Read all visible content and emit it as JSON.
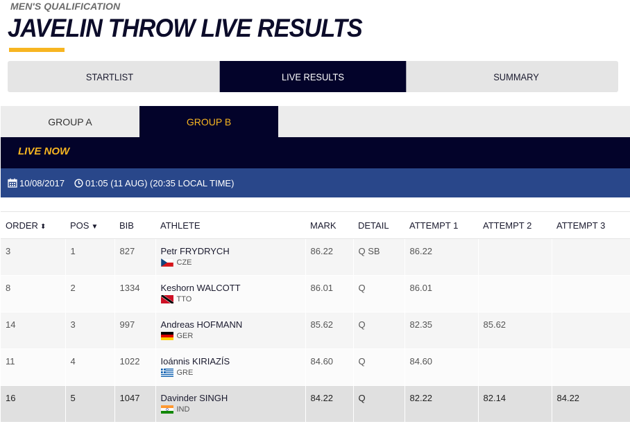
{
  "header": {
    "subtitle": "MEN'S QUALIFICATION",
    "title": "JAVELIN THROW LIVE RESULTS"
  },
  "main_tabs": [
    {
      "label": "STARTLIST",
      "active": false
    },
    {
      "label": "LIVE RESULTS",
      "active": true
    },
    {
      "label": "SUMMARY",
      "active": false
    }
  ],
  "groups": [
    {
      "label": "GROUP A",
      "active": false
    },
    {
      "label": "GROUP B",
      "active": true
    }
  ],
  "live_label": "LIVE NOW",
  "date_info": {
    "date": "10/08/2017",
    "time": "01:05 (11 AUG) (20:35 LOCAL TIME)",
    "calendar_icon": "calendar-icon",
    "clock_icon": "clock-icon"
  },
  "table": {
    "columns": {
      "order": "ORDER",
      "pos": "POS",
      "bib": "BIB",
      "athlete": "ATHLETE",
      "mark": "MARK",
      "detail": "DETAIL",
      "attempt1": "ATTEMPT 1",
      "attempt2": "ATTEMPT 2",
      "attempt3": "ATTEMPT 3"
    },
    "rows": [
      {
        "order": "3",
        "pos": "1",
        "bib": "827",
        "name": "Petr FRYDRYCH",
        "country": "CZE",
        "mark": "86.22",
        "detail": "Q SB",
        "a1": "86.22",
        "a2": "",
        "a3": ""
      },
      {
        "order": "8",
        "pos": "2",
        "bib": "1334",
        "name": "Keshorn WALCOTT",
        "country": "TTO",
        "mark": "86.01",
        "detail": "Q",
        "a1": "86.01",
        "a2": "",
        "a3": ""
      },
      {
        "order": "14",
        "pos": "3",
        "bib": "997",
        "name": "Andreas HOFMANN",
        "country": "GER",
        "mark": "85.62",
        "detail": "Q",
        "a1": "82.35",
        "a2": "85.62",
        "a3": ""
      },
      {
        "order": "11",
        "pos": "4",
        "bib": "1022",
        "name": "Ioánnis KIRIAZÍS",
        "country": "GRE",
        "mark": "84.60",
        "detail": "Q",
        "a1": "84.60",
        "a2": "",
        "a3": ""
      },
      {
        "order": "16",
        "pos": "5",
        "bib": "1047",
        "name": "Davinder SINGH",
        "country": "IND",
        "mark": "84.22",
        "detail": "Q",
        "a1": "82.22",
        "a2": "82.14",
        "a3": "84.22"
      }
    ]
  },
  "colors": {
    "navy": "#03032a",
    "accent_yellow": "#f7b521",
    "date_bar_blue": "#29478a"
  }
}
